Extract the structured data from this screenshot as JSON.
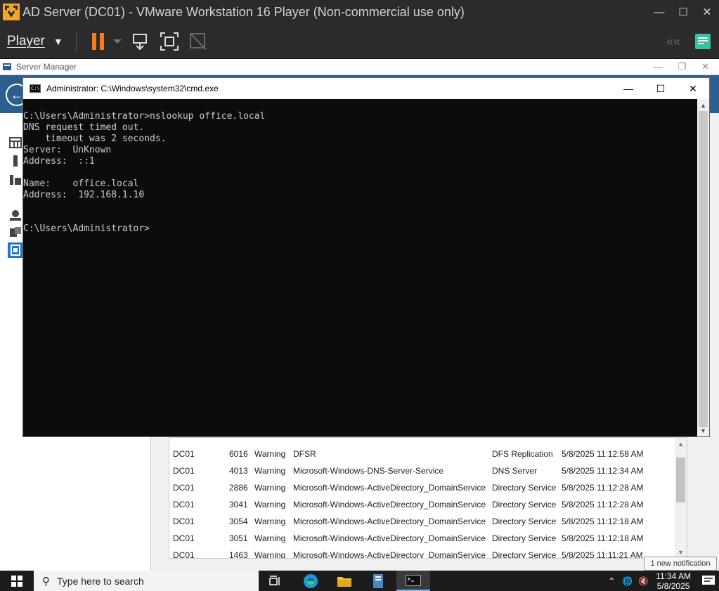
{
  "vmware": {
    "title": "AD Server (DC01) - VMware Workstation 16 Player (Non-commercial use only)",
    "player_menu_label": "Player",
    "colors": {
      "pause": "#f47b20",
      "bar": "#2b2b2b",
      "accent_green": "#3cc0a0"
    },
    "toolbar_icons": [
      "pause-icon",
      "pause-dropdown-icon",
      "send-ctrl-alt-del-icon",
      "fullscreen-icon",
      "unity-icon",
      "back-arrows-icon",
      "notes-icon"
    ]
  },
  "server_manager": {
    "title": "Server Manager",
    "header_color": "#2c5f8e",
    "nav_icons": [
      "dashboard-icon",
      "local-server-icon",
      "all-servers-icon",
      "ad-ds-icon",
      "dns-icon",
      "file-storage-icon"
    ]
  },
  "cmd": {
    "title": "Administrator: C:\\Windows\\system32\\cmd.exe",
    "lines": [
      "C:\\Users\\Administrator>nslookup office.local",
      "DNS request timed out.",
      "    timeout was 2 seconds.",
      "Server:  UnKnown",
      "Address:  ::1",
      "",
      "Name:    office.local",
      "Address:  192.168.1.10",
      "",
      "",
      "C:\\Users\\Administrator>"
    ]
  },
  "events": {
    "rows": [
      {
        "server": "DC01",
        "id": "6016",
        "severity": "Warning",
        "source": "DFSR",
        "category": "DFS Replication",
        "datetime": "5/8/2025 11:12:58 AM"
      },
      {
        "server": "DC01",
        "id": "4013",
        "severity": "Warning",
        "source": "Microsoft-Windows-DNS-Server-Service",
        "category": "DNS Server",
        "datetime": "5/8/2025 11:12:34 AM"
      },
      {
        "server": "DC01",
        "id": "2886",
        "severity": "Warning",
        "source": "Microsoft-Windows-ActiveDirectory_DomainService",
        "category": "Directory Service",
        "datetime": "5/8/2025 11:12:28 AM"
      },
      {
        "server": "DC01",
        "id": "3041",
        "severity": "Warning",
        "source": "Microsoft-Windows-ActiveDirectory_DomainService",
        "category": "Directory Service",
        "datetime": "5/8/2025 11:12:28 AM"
      },
      {
        "server": "DC01",
        "id": "3054",
        "severity": "Warning",
        "source": "Microsoft-Windows-ActiveDirectory_DomainService",
        "category": "Directory Service",
        "datetime": "5/8/2025 11:12:18 AM"
      },
      {
        "server": "DC01",
        "id": "3051",
        "severity": "Warning",
        "source": "Microsoft-Windows-ActiveDirectory_DomainService",
        "category": "Directory Service",
        "datetime": "5/8/2025 11:12:18 AM"
      },
      {
        "server": "DC01",
        "id": "1463",
        "severity": "Warning",
        "source": "Microsoft-Windows-ActiveDirectory_DomainService",
        "category": "Directory Service",
        "datetime": "5/8/2025 11:11:21 AM"
      }
    ]
  },
  "taskbar": {
    "search_placeholder": "Type here to search",
    "time": "11:34 AM",
    "date": "5/8/2025",
    "notification_tooltip": "1 new notification",
    "notification_count": "1",
    "pinned": [
      "task-view-icon",
      "edge-icon",
      "file-explorer-icon",
      "server-manager-icon",
      "cmd-icon"
    ]
  }
}
